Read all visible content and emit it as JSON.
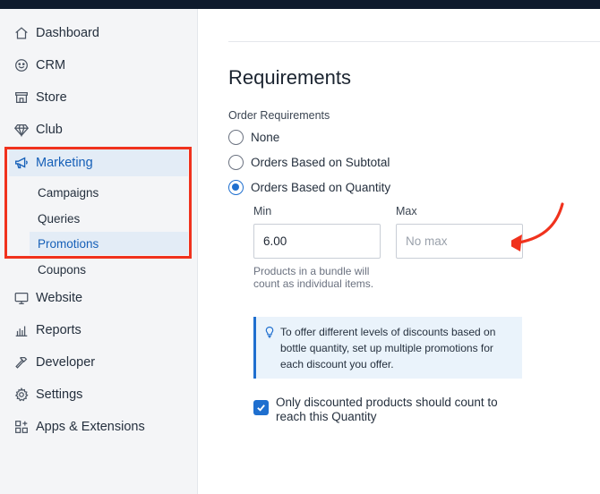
{
  "sidebar": {
    "items": [
      {
        "label": "Dashboard",
        "icon": "home-icon"
      },
      {
        "label": "CRM",
        "icon": "smiley-icon"
      },
      {
        "label": "Store",
        "icon": "storefront-icon"
      },
      {
        "label": "Club",
        "icon": "diamond-icon"
      },
      {
        "label": "Marketing",
        "icon": "megaphone-icon"
      },
      {
        "label": "Website",
        "icon": "monitor-icon"
      },
      {
        "label": "Reports",
        "icon": "bar-chart-icon"
      },
      {
        "label": "Developer",
        "icon": "hammer-icon"
      },
      {
        "label": "Settings",
        "icon": "gear-icon"
      },
      {
        "label": "Apps & Extensions",
        "icon": "apps-icon"
      }
    ],
    "marketing_sub": [
      {
        "label": "Campaigns"
      },
      {
        "label": "Queries"
      },
      {
        "label": "Promotions"
      },
      {
        "label": "Coupons"
      }
    ],
    "active_item": "Marketing",
    "active_sub": "Promotions"
  },
  "main": {
    "title": "Requirements",
    "group_label": "Order Requirements",
    "options": [
      {
        "label": "None",
        "checked": false
      },
      {
        "label": "Orders Based on Subtotal",
        "checked": false
      },
      {
        "label": "Orders Based on Quantity",
        "checked": true
      }
    ],
    "min": {
      "label": "Min",
      "value": "6.00"
    },
    "max": {
      "label": "Max",
      "value": "",
      "placeholder": "No max"
    },
    "help_text": "Products in a bundle will count as individual items.",
    "info": {
      "icon": "lightbulb-icon",
      "text": "To offer different levels of discounts based on bottle quantity, set up multiple promotions for each discount you offer."
    },
    "checkbox": {
      "label": "Only discounted products should count to reach this Quantity",
      "checked": true
    }
  },
  "colors": {
    "accent": "#1f6fcf",
    "annotation": "#f0321d",
    "active_bg": "#e3ecf6",
    "topbar": "#0f1b2d"
  }
}
